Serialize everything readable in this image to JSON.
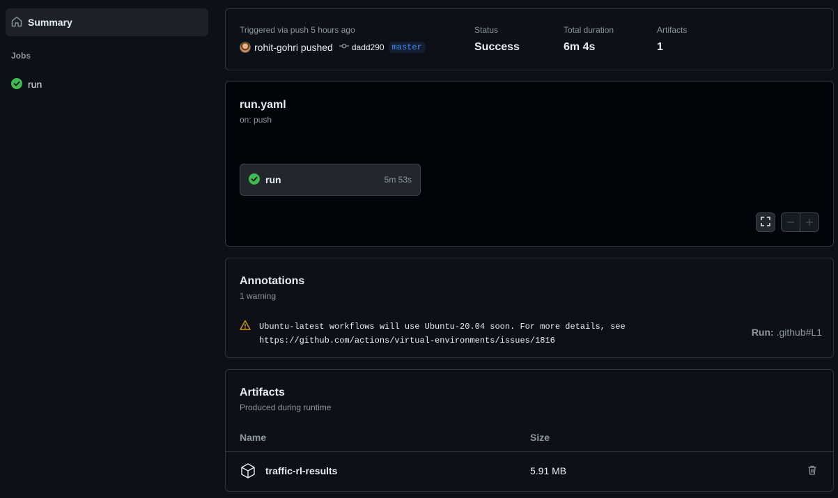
{
  "sidebar": {
    "summary_label": "Summary",
    "jobs_heading": "Jobs",
    "jobs": [
      {
        "label": "run",
        "status": "success"
      }
    ]
  },
  "summary": {
    "trigger_text": "Triggered via push 5 hours ago",
    "actor_text": "rohit-gohri pushed",
    "commit": "dadd290",
    "branch": "master",
    "status_label": "Status",
    "status_value": "Success",
    "duration_label": "Total duration",
    "duration_value": "6m 4s",
    "artifacts_label": "Artifacts",
    "artifacts_value": "1"
  },
  "workflow": {
    "file": "run.yaml",
    "trigger": "on: push",
    "job_name": "run",
    "job_duration": "5m 53s"
  },
  "annotations": {
    "title": "Annotations",
    "count": "1 warning",
    "items": [
      {
        "message_line1": "Ubuntu-latest workflows will use Ubuntu-20.04 soon. For more details, see",
        "message_line2": "https://github.com/actions/virtual-environments/issues/1816",
        "location_prefix": "Run:",
        "location": ".github#L1"
      }
    ]
  },
  "artifacts": {
    "title": "Artifacts",
    "subtitle": "Produced during runtime",
    "col_name": "Name",
    "col_size": "Size",
    "rows": [
      {
        "name": "traffic-rl-results",
        "size": "5.91 MB"
      }
    ]
  },
  "colors": {
    "success": "#3fb950",
    "warning": "#d29922",
    "link": "#4493f8"
  }
}
